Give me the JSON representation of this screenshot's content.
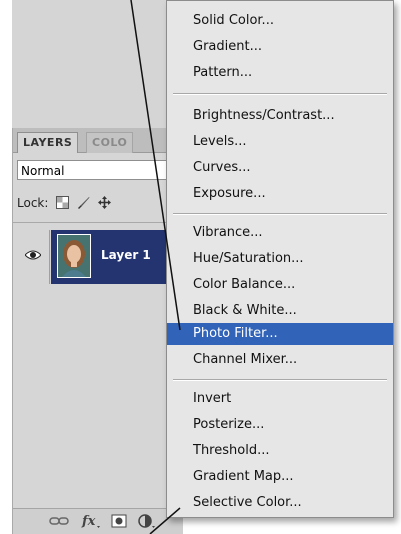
{
  "panel": {
    "tabs": [
      {
        "label": "LAYERS"
      },
      {
        "label": "COLO"
      }
    ],
    "blend_mode": "Normal",
    "lock_label": "Lock:",
    "layer": {
      "name": "Layer 1"
    }
  },
  "menu": {
    "items": [
      {
        "label": "Solid Color..."
      },
      {
        "label": "Gradient..."
      },
      {
        "label": "Pattern..."
      },
      {
        "label": "Brightness/Contrast..."
      },
      {
        "label": "Levels..."
      },
      {
        "label": "Curves..."
      },
      {
        "label": "Exposure..."
      },
      {
        "label": "Vibrance..."
      },
      {
        "label": "Hue/Saturation..."
      },
      {
        "label": "Color Balance..."
      },
      {
        "label": "Black & White..."
      },
      {
        "label": "Photo Filter..."
      },
      {
        "label": "Channel Mixer..."
      },
      {
        "label": "Invert"
      },
      {
        "label": "Posterize..."
      },
      {
        "label": "Threshold..."
      },
      {
        "label": "Gradient Map..."
      },
      {
        "label": "Selective Color..."
      }
    ],
    "highlighted": "Photo Filter..."
  },
  "colors": {
    "highlight": "#3163b9",
    "layer_selected": "#233470",
    "menu_bg": "#e6e6e6"
  }
}
